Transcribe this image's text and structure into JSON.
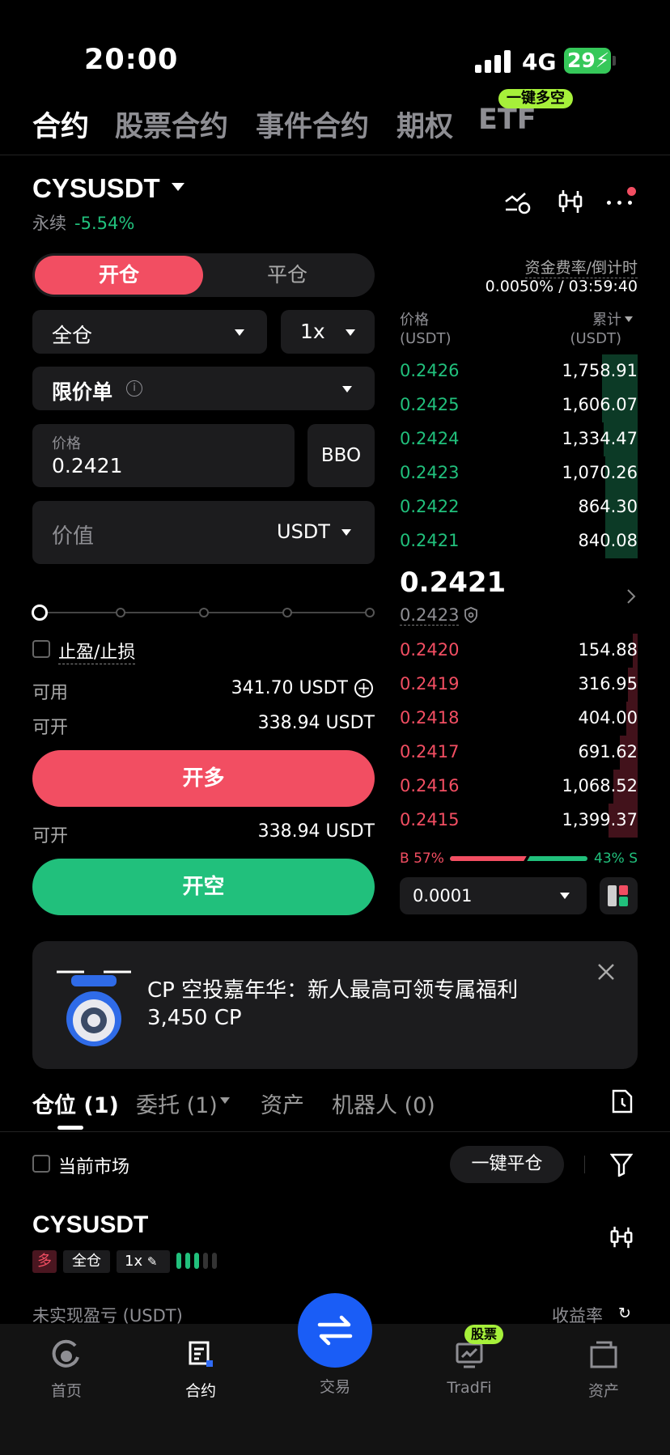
{
  "status_bar": {
    "time": "20:00",
    "network": "4G",
    "battery": "29"
  },
  "top_tabs": {
    "items": [
      "合约",
      "股票合约",
      "事件合约",
      "期权",
      "ETF"
    ],
    "promo": "一键多空"
  },
  "header": {
    "symbol": "CYSUSDT",
    "type": "永续",
    "change": "-5.54%"
  },
  "order_form": {
    "open_tab": "开仓",
    "close_tab": "平仓",
    "margin_mode": "全仓",
    "leverage": "1x",
    "order_type": "限价单",
    "price_label": "价格",
    "price_value": "0.2421",
    "bbo": "BBO",
    "value_placeholder": "价值",
    "value_unit": "USDT",
    "tp_sl": "止盈/止损",
    "available_label": "可用",
    "available_value": "341.70 USDT",
    "can_open_label": "可开",
    "can_open_value": "338.94 USDT",
    "long_btn": "开多",
    "can_open_label2": "可开",
    "can_open_value2": "338.94 USDT",
    "short_btn": "开空"
  },
  "funding": {
    "label": "资金费率/倒计时",
    "value": "0.0050% / 03:59:40"
  },
  "orderbook": {
    "price_header": "价格",
    "price_unit": "(USDT)",
    "total_header": "累计",
    "total_unit": "(USDT)",
    "asks": [
      {
        "price": "0.2426",
        "total": "1,758.91"
      },
      {
        "price": "0.2425",
        "total": "1,606.07"
      },
      {
        "price": "0.2424",
        "total": "1,334.47"
      },
      {
        "price": "0.2423",
        "total": "1,070.26"
      },
      {
        "price": "0.2422",
        "total": "864.30"
      },
      {
        "price": "0.2421",
        "total": "840.08"
      }
    ],
    "last_price": "0.2421",
    "mark_price": "0.2423",
    "bids": [
      {
        "price": "0.2420",
        "total": "154.88"
      },
      {
        "price": "0.2419",
        "total": "316.95"
      },
      {
        "price": "0.2418",
        "total": "404.00"
      },
      {
        "price": "0.2417",
        "total": "691.62"
      },
      {
        "price": "0.2416",
        "total": "1,068.52"
      },
      {
        "price": "0.2415",
        "total": "1,399.37"
      }
    ],
    "buy_ratio": "B 57%",
    "sell_ratio": "43% S",
    "buy_fraction": 0.57,
    "precision": "0.0001"
  },
  "banner": {
    "line1": "CP 空投嘉年华：新人最高可领专属福利",
    "line2": "3,450 CP"
  },
  "bottom_tabs": {
    "positions": "仓位 (1)",
    "orders": "委托 (1)",
    "assets": "资产",
    "bots": "机器人 (0)"
  },
  "positions": {
    "current_market": "当前市场",
    "close_all": "一键平仓",
    "symbol": "CYSUSDT",
    "side": "多",
    "mode": "全仓",
    "lev": "1x",
    "pnl_label": "未实现盈亏 (USDT)",
    "roi_label": "收益率"
  },
  "nav": {
    "home": "首页",
    "futures": "合约",
    "trade": "交易",
    "tradfi": "TradFi",
    "tradfi_badge": "股票",
    "assets": "资产"
  }
}
